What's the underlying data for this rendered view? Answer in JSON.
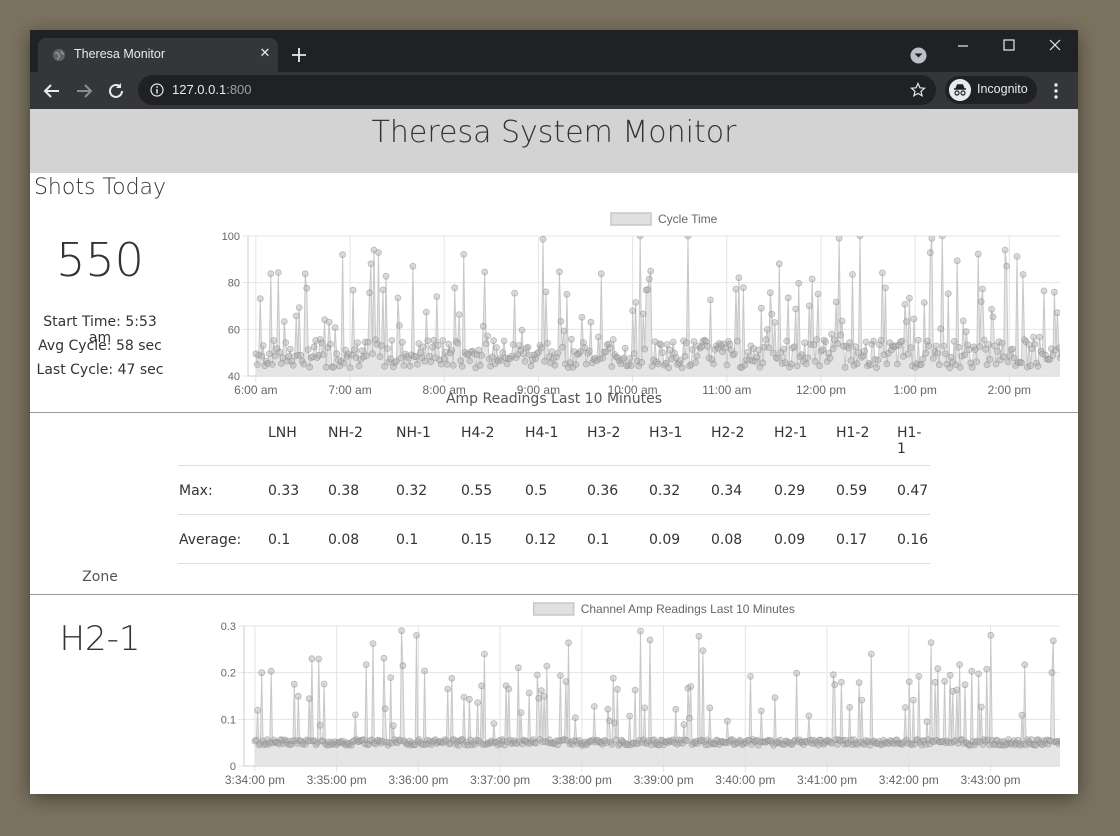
{
  "browser": {
    "tab_title": "Theresa Monitor",
    "url_host": "127.0.0.1",
    "url_port": ":800",
    "profile_label": "Incognito"
  },
  "page": {
    "title": "Theresa System Monitor",
    "shots": {
      "heading": "Shots Today",
      "count": "550",
      "start_time": "Start Time: 5:53 am",
      "avg_cycle": "Avg Cycle: 58 sec",
      "last_cycle": "Last Cycle: 47 sec"
    },
    "amp": {
      "title": "Amp Readings Last 10 Minutes",
      "columns": [
        "LNH",
        "NH-2",
        "NH-1",
        "H4-2",
        "H4-1",
        "H3-2",
        "H3-1",
        "H2-2",
        "H2-1",
        "H1-2",
        "H1-1"
      ],
      "rows": [
        {
          "label": "Max:",
          "values": [
            "0.33",
            "0.38",
            "0.32",
            "0.55",
            "0.5",
            "0.36",
            "0.32",
            "0.34",
            "0.29",
            "0.59",
            "0.47"
          ]
        },
        {
          "label": "Average:",
          "values": [
            "0.1",
            "0.08",
            "0.1",
            "0.15",
            "0.12",
            "0.1",
            "0.09",
            "0.08",
            "0.09",
            "0.17",
            "0.16"
          ]
        }
      ]
    },
    "zone": {
      "heading": "Zone",
      "value": "H2-1"
    }
  },
  "colors": {
    "header_bg": "#d3d3d3",
    "series_fill": "#e0e0e0",
    "series_line": "#c8c8c8",
    "point_fill": "#b0b0b0",
    "point_stroke": "#8c8c8c",
    "grid": "#e4e4e4"
  },
  "chart_data": [
    {
      "type": "line",
      "legend": "Cycle Time",
      "legend_position": "top",
      "ylim": [
        40,
        100
      ],
      "yticks": [
        40,
        60,
        80,
        100
      ],
      "x_tick_labels": [
        "6:00 am",
        "7:00 am",
        "8:00 am",
        "9:00 am",
        "10:00 am",
        "11:00 am",
        "12:00 pm",
        "1:00 pm",
        "2:00 pm"
      ],
      "x_range_minutes": [
        0,
        525
      ],
      "grid": true,
      "series": [
        {
          "points_generated": true,
          "x_start_minutes": 0,
          "x_end_minutes": 523,
          "count": 550,
          "base_value": 49,
          "value_range": [
            42,
            100
          ],
          "spikes": [
            {
              "x": 55,
              "y": 92
            },
            {
              "x": 75,
              "y": 94
            },
            {
              "x": 100,
              "y": 87
            },
            {
              "x": 245,
              "y": 100
            },
            {
              "x": 275,
              "y": 100
            },
            {
              "x": 385,
              "y": 100
            },
            {
              "x": 437,
              "y": 100
            },
            {
              "x": 477,
              "y": 94
            },
            {
              "x": 520,
              "y": 100
            }
          ]
        }
      ]
    },
    {
      "type": "line",
      "legend": "Channel Amp Readings Last 10 Minutes",
      "legend_position": "top",
      "ylim": [
        0,
        0.3
      ],
      "yticks": [
        "0",
        "0.1",
        "0.2",
        "0.3"
      ],
      "x_tick_labels": [
        "3:34:00 pm",
        "3:35:00 pm",
        "3:36:00 pm",
        "3:37:00 pm",
        "3:38:00 pm",
        "3:39:00 pm",
        "3:40:00 pm",
        "3:41:00 pm",
        "3:42:00 pm",
        "3:43:00 pm"
      ],
      "x_range_seconds": [
        0,
        600
      ],
      "grid": true,
      "series": [
        {
          "points_generated": true,
          "count": 600,
          "base_value": 0.05,
          "value_range": [
            0.02,
            0.29
          ],
          "spikes": [
            {
              "x": 5,
              "y": 0.2
            },
            {
              "x": 42,
              "y": 0.23
            },
            {
              "x": 108,
              "y": 0.29
            },
            {
              "x": 168,
              "y": 0.24
            },
            {
              "x": 290,
              "y": 0.27
            },
            {
              "x": 452,
              "y": 0.24
            },
            {
              "x": 540,
              "y": 0.28
            },
            {
              "x": 585,
              "y": 0.2
            }
          ]
        }
      ]
    }
  ]
}
